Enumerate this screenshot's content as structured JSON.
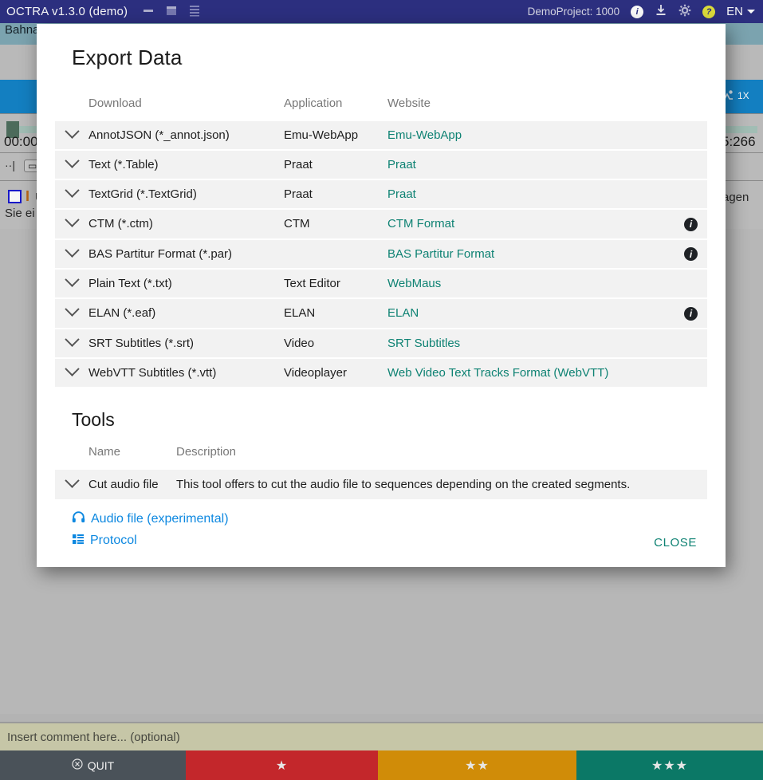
{
  "titlebar": {
    "app_title": "OCTRA v1.3.0 (demo)",
    "window_icons": [
      "minimize-icon",
      "restore-icon",
      "menu-icon"
    ],
    "project_label": "DemoProject: 1000",
    "info_icon": "i",
    "help_icon": "?",
    "language": "EN",
    "bg_color": "#2e3184"
  },
  "background_app": {
    "tab_label": "Bahna",
    "time_left": "00:00",
    "time_right": "5:266",
    "speed_label": "1X",
    "hint_text": "U",
    "hint_sub": "Sie ei",
    "right_word": "agen"
  },
  "modal": {
    "title": "Export Data",
    "export_table": {
      "columns": [
        "Download",
        "Application",
        "Website"
      ],
      "rows": [
        {
          "download": "AnnotJSON (*_annot.json)",
          "application": "Emu-WebApp",
          "website": "Emu-WebApp",
          "info": false
        },
        {
          "download": "Text (*.Table)",
          "application": "Praat",
          "website": "Praat",
          "info": false
        },
        {
          "download": "TextGrid (*.TextGrid)",
          "application": "Praat",
          "website": "Praat",
          "info": false
        },
        {
          "download": "CTM (*.ctm)",
          "application": "CTM",
          "website": "CTM Format",
          "info": true
        },
        {
          "download": "BAS Partitur Format (*.par)",
          "application": "",
          "website": "BAS Partitur Format",
          "info": true
        },
        {
          "download": "Plain Text (*.txt)",
          "application": "Text Editor",
          "website": "WebMaus",
          "info": false
        },
        {
          "download": "ELAN (*.eaf)",
          "application": "ELAN",
          "website": "ELAN",
          "info": true
        },
        {
          "download": "SRT Subtitles (*.srt)",
          "application": "Video",
          "website": "SRT Subtitles",
          "info": false
        },
        {
          "download": "WebVTT Subtitles (*.vtt)",
          "application": "Videoplayer",
          "website": "Web Video Text Tracks Format (WebVTT)",
          "info": false
        }
      ]
    },
    "tools": {
      "title": "Tools",
      "columns": [
        "Name",
        "Description"
      ],
      "rows": [
        {
          "name": "Cut audio file",
          "description": "This tool offers to cut the audio file to sequences depending on the created segments."
        }
      ]
    },
    "downloads": [
      {
        "icon": "headphones-icon",
        "label": "Audio file (experimental)"
      },
      {
        "icon": "list-icon",
        "label": "Protocol"
      }
    ],
    "close_label": "CLOSE",
    "link_color": "#0e8273",
    "download_link_color": "#0d88e0"
  },
  "comment": {
    "placeholder": "Insert comment here... (optional)",
    "value": ""
  },
  "actionbar": {
    "quit_label": "QUIT",
    "buttons": [
      {
        "label": "QUIT",
        "stars": "",
        "color": "#4a5259"
      },
      {
        "label": "",
        "stars": "★",
        "color": "#c3272b"
      },
      {
        "label": "",
        "stars": "★★",
        "color": "#d08c08"
      },
      {
        "label": "",
        "stars": "★★★",
        "color": "#0b7866"
      }
    ]
  }
}
